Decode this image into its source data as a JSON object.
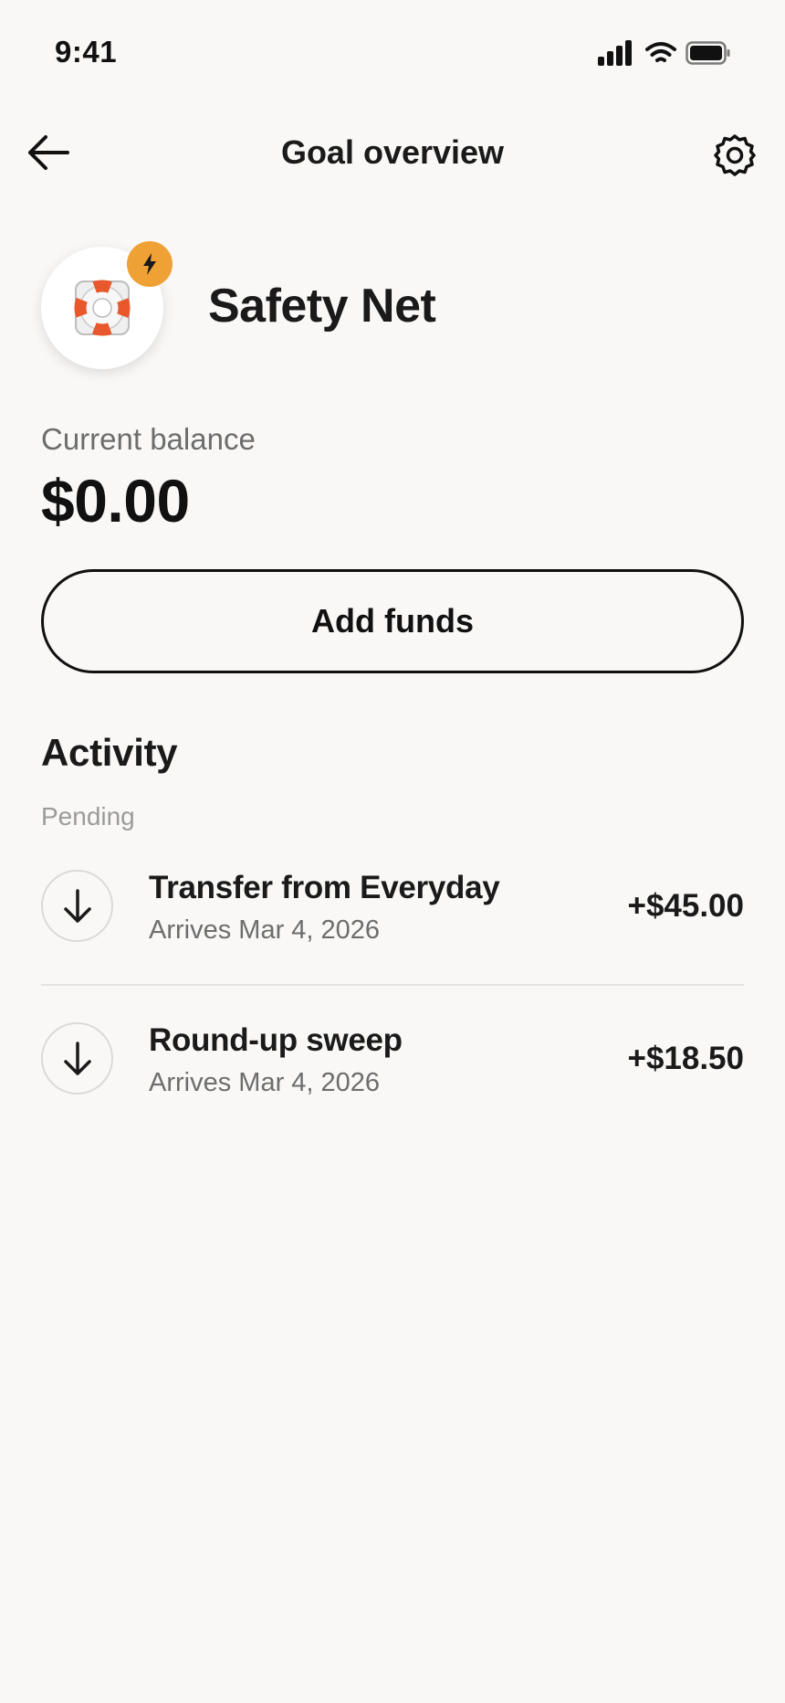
{
  "status_bar": {
    "time": "9:41",
    "icons": [
      "signal-icon",
      "wifi-icon",
      "battery-icon"
    ]
  },
  "nav": {
    "back_icon": "arrow-left-icon",
    "title": "Goal overview",
    "settings_icon": "gear-icon"
  },
  "goal": {
    "name": "Safety Net",
    "icon": "lifebuoy-icon",
    "badge_icon": "lightning-bolt-icon",
    "badge_color": "#f0a135"
  },
  "balance": {
    "label": "Current balance",
    "amount": "$0.00"
  },
  "actions": {
    "add_funds_label": "Add funds"
  },
  "activity": {
    "title": "Activity",
    "section_label": "Pending",
    "transactions": [
      {
        "title": "Transfer from Everyday",
        "subtitle": "Arrives Mar 4, 2026",
        "amount": "+$45.00",
        "icon": "arrow-down-icon"
      },
      {
        "title": "Round-up sweep",
        "subtitle": "Arrives Mar 4, 2026",
        "amount": "+$18.50",
        "icon": "arrow-down-icon"
      }
    ]
  }
}
